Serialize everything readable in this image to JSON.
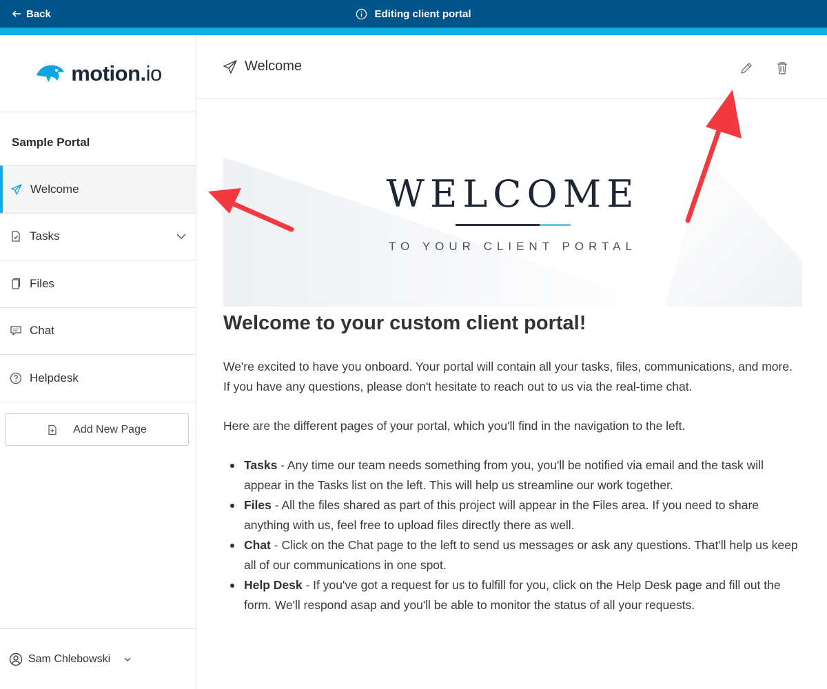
{
  "topbar": {
    "back_label": "Back",
    "title": "Editing client portal",
    "colors": {
      "bar": "#00548c",
      "accent": "#0bb0e5"
    }
  },
  "sidebar": {
    "logo_text_main": "motion",
    "logo_text_dot": ".",
    "logo_text_io": "io",
    "portal_name": "Sample Portal",
    "items": [
      {
        "label": "Welcome",
        "icon": "paper-plane-icon",
        "active": true
      },
      {
        "label": "Tasks",
        "icon": "task-doc-icon",
        "expandable": true
      },
      {
        "label": "Files",
        "icon": "files-icon"
      },
      {
        "label": "Chat",
        "icon": "chat-icon"
      },
      {
        "label": "Helpdesk",
        "icon": "help-circle-icon"
      }
    ],
    "add_page_label": "Add New Page",
    "user_name": "Sam Chlebowski"
  },
  "main": {
    "page_title": "Welcome",
    "actions": {
      "edit_icon": "pencil-icon",
      "delete_icon": "trash-icon"
    },
    "banner": {
      "title": "WELCOME",
      "subtitle": "TO YOUR CLIENT PORTAL"
    },
    "heading": "Welcome to your custom client portal!",
    "intro": "We're excited to have you onboard. Your portal will contain all your tasks, files, communications, and more. If you have any questions, please don't hesitate to reach out to us via the real-time chat.",
    "pages_intro": "Here are the different pages of your portal, which you'll find in the navigation to the left.",
    "bullets": [
      {
        "term": "Tasks",
        "text": " - Any time our team needs something from you, you'll be notified via email and the task will appear in the Tasks list on the left. This will help us streamline our work together."
      },
      {
        "term": "Files",
        "text": " - All the files shared as part of this project will appear in the Files area. If you need to share anything with us, feel free to upload files directly there as well."
      },
      {
        "term": "Chat",
        "text": " - Click on the Chat page to the left to send us messages or ask any questions. That'll help us keep all of our communications in one spot."
      },
      {
        "term": "Help Desk",
        "text": " - If you've got a request for us to fulfill for you, click on the Help Desk page and fill out the form. We'll respond asap and you'll be able to monitor the status of all your requests."
      }
    ]
  },
  "annotations": {
    "arrow_color": "#f2393f"
  }
}
